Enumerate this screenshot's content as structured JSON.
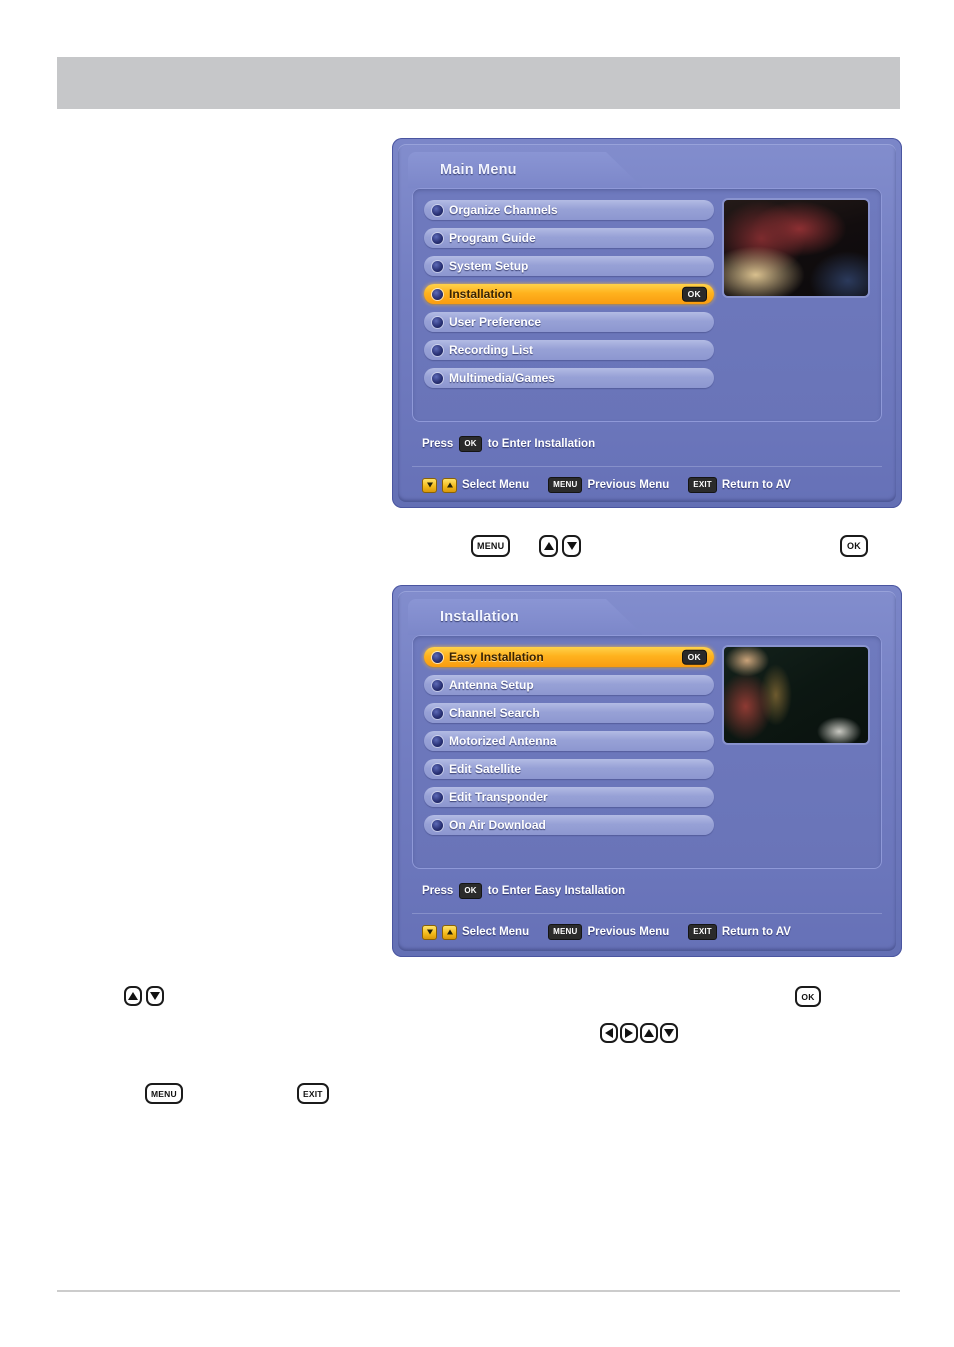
{
  "page": {
    "header_bar": "",
    "footer_rule": ""
  },
  "menus": [
    {
      "title": "Main Menu",
      "items": [
        {
          "label": "Organize Channels",
          "selected": false,
          "chip": ""
        },
        {
          "label": "Program Guide",
          "selected": false,
          "chip": ""
        },
        {
          "label": "System Setup",
          "selected": false,
          "chip": ""
        },
        {
          "label": "Installation",
          "selected": true,
          "chip": "OK"
        },
        {
          "label": "User Preference",
          "selected": false,
          "chip": ""
        },
        {
          "label": "Recording List",
          "selected": false,
          "chip": ""
        },
        {
          "label": "Multimedia/Games",
          "selected": false,
          "chip": ""
        }
      ],
      "hint": {
        "press_label": "Press",
        "key": "OK",
        "action_label": "to Enter Installation"
      },
      "status": {
        "select_label": "Select Menu",
        "previous_key": "MENU",
        "previous_label": "Previous Menu",
        "exit_key": "EXIT",
        "exit_label": "Return to AV"
      }
    },
    {
      "title": "Installation",
      "items": [
        {
          "label": "Easy Installation",
          "selected": true,
          "chip": "OK"
        },
        {
          "label": "Antenna Setup",
          "selected": false,
          "chip": ""
        },
        {
          "label": "Channel Search",
          "selected": false,
          "chip": ""
        },
        {
          "label": "Motorized Antenna",
          "selected": false,
          "chip": ""
        },
        {
          "label": "Edit Satellite",
          "selected": false,
          "chip": ""
        },
        {
          "label": "Edit Transponder",
          "selected": false,
          "chip": ""
        },
        {
          "label": "On Air Download",
          "selected": false,
          "chip": ""
        }
      ],
      "hint": {
        "press_label": "Press",
        "key": "OK",
        "action_label": "to Enter Easy Installation"
      },
      "status": {
        "select_label": "Select Menu",
        "previous_key": "MENU",
        "previous_label": "Previous Menu",
        "exit_key": "EXIT",
        "exit_label": "Return to AV"
      }
    }
  ],
  "keys": {
    "menu": "MENU",
    "exit": "EXIT",
    "ok": "OK"
  }
}
